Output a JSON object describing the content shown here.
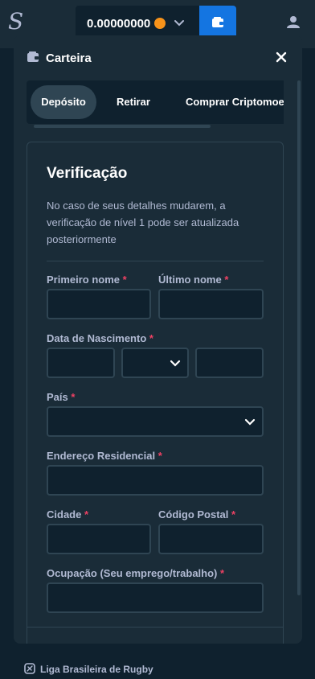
{
  "topbar": {
    "logo_icon": "stake-logo-icon",
    "balance": "0.00000000",
    "currency_icon": "bitcoin-icon",
    "wallet_icon": "wallet-icon",
    "user_icon": "user-icon"
  },
  "modal": {
    "title": "Carteira",
    "title_icon": "wallet-icon",
    "close_icon": "close-icon",
    "tabs": [
      {
        "label": "Depósito",
        "active": true
      },
      {
        "label": "Retirar",
        "active": false
      },
      {
        "label": "Comprar Criptomoedas",
        "active": false
      }
    ]
  },
  "verification": {
    "title": "Verificação",
    "description": "No caso de seus detalhes mudarem, a verificação de nível 1 pode ser atualizada posteriormente",
    "required_mark": "*",
    "first_name": {
      "label": "Primeiro nome",
      "value": ""
    },
    "last_name": {
      "label": "Último nome",
      "value": ""
    },
    "birth_date": {
      "label": "Data de Nascimento",
      "day": "",
      "month": "",
      "year": ""
    },
    "country": {
      "label": "País",
      "value": ""
    },
    "address": {
      "label": "Endereço Residencial",
      "value": ""
    },
    "city": {
      "label": "Cidade",
      "value": ""
    },
    "postal_code": {
      "label": "Código Postal",
      "value": ""
    },
    "occupation": {
      "label": "Ocupação (Seu emprego/trabalho)",
      "value": ""
    }
  },
  "footer": {
    "brand_icon": "rugby-league-icon",
    "brand": "Liga Brasileira de Rugby"
  },
  "colors": {
    "background": "#0f212e",
    "panel": "#1a2c38",
    "border": "#2f4553",
    "accent": "#1475e1",
    "required": "#ed4163",
    "muted_text": "#b1bad3"
  }
}
